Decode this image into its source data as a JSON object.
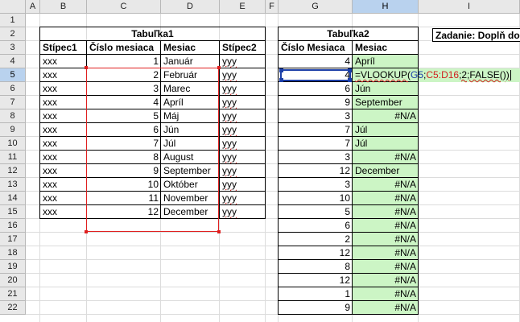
{
  "columns": [
    "A",
    "B",
    "C",
    "D",
    "E",
    "F",
    "G",
    "H",
    "I"
  ],
  "rows": [
    "1",
    "2",
    "3",
    "4",
    "5",
    "6",
    "7",
    "8",
    "9",
    "10",
    "11",
    "12",
    "13",
    "14",
    "15",
    "16",
    "17",
    "18",
    "19",
    "20",
    "21",
    "22"
  ],
  "table1": {
    "title": "Tabuľka1",
    "headers": [
      "Stípec1",
      "Číslo mesiaca",
      "Mesiac",
      "Stípec2"
    ],
    "rows": [
      [
        "xxx",
        "1",
        "Január",
        "yyy"
      ],
      [
        "xxx",
        "2",
        "Február",
        "yyy"
      ],
      [
        "xxx",
        "3",
        "Marec",
        "yyy"
      ],
      [
        "xxx",
        "4",
        "Apríl",
        "yyy"
      ],
      [
        "xxx",
        "5",
        "Máj",
        "yyy"
      ],
      [
        "xxx",
        "6",
        "Jún",
        "yyy"
      ],
      [
        "xxx",
        "7",
        "Júl",
        "yyy"
      ],
      [
        "xxx",
        "8",
        "August",
        "yyy"
      ],
      [
        "xxx",
        "9",
        "September",
        "yyy"
      ],
      [
        "xxx",
        "10",
        "Október",
        "yyy"
      ],
      [
        "xxx",
        "11",
        "November",
        "yyy"
      ],
      [
        "xxx",
        "12",
        "December",
        "yyy"
      ]
    ]
  },
  "table2": {
    "title": "Tabuľka2",
    "headers": [
      "Číslo Mesiaca",
      "Mesiac"
    ],
    "rows": [
      [
        "4",
        "Apríl"
      ],
      [
        "4",
        ""
      ],
      [
        "6",
        "Jún"
      ],
      [
        "9",
        "September"
      ],
      [
        "3",
        "#N/A"
      ],
      [
        "7",
        "Júl"
      ],
      [
        "7",
        "Júl"
      ],
      [
        "3",
        "#N/A"
      ],
      [
        "12",
        "December"
      ],
      [
        "3",
        "#N/A"
      ],
      [
        "10",
        "#N/A"
      ],
      [
        "5",
        "#N/A"
      ],
      [
        "6",
        "#N/A"
      ],
      [
        "2",
        "#N/A"
      ],
      [
        "12",
        "#N/A"
      ],
      [
        "8",
        "#N/A"
      ],
      [
        "12",
        "#N/A"
      ],
      [
        "1",
        "#N/A"
      ],
      [
        "9",
        "#N/A"
      ]
    ]
  },
  "formula": {
    "prefix": "=VLOOKUP(",
    "ref1": "G5",
    "sep1": ";",
    "ref2": "C5:D16",
    "rest": ";2;FALSE())"
  },
  "task_label": "Zadanie: Doplň do T"
}
